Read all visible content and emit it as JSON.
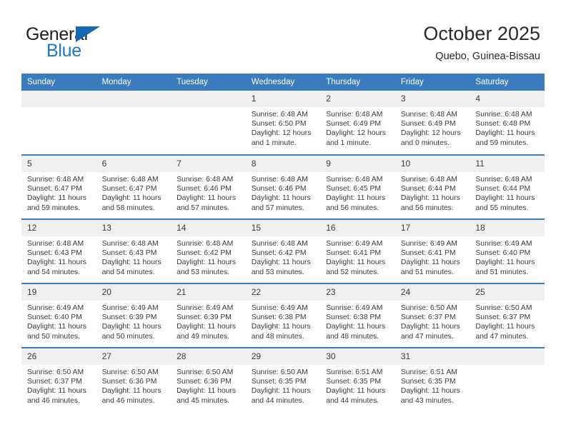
{
  "brand": {
    "name_top": "General",
    "name_bottom": "Blue",
    "accent_color": "#1a7ac4",
    "triangle_color": "#1668b3"
  },
  "header": {
    "title": "October 2025",
    "subtitle": "Quebo, Guinea-Bissau"
  },
  "calendar": {
    "header_bg": "#3a7cbe",
    "daynum_bg": "#efeff0",
    "weekdays": [
      "Sunday",
      "Monday",
      "Tuesday",
      "Wednesday",
      "Thursday",
      "Friday",
      "Saturday"
    ],
    "weeks": [
      [
        {
          "day": "",
          "sunrise": "",
          "sunset": "",
          "daylight_1": "",
          "daylight_2": ""
        },
        {
          "day": "",
          "sunrise": "",
          "sunset": "",
          "daylight_1": "",
          "daylight_2": ""
        },
        {
          "day": "",
          "sunrise": "",
          "sunset": "",
          "daylight_1": "",
          "daylight_2": ""
        },
        {
          "day": "1",
          "sunrise": "Sunrise: 6:48 AM",
          "sunset": "Sunset: 6:50 PM",
          "daylight_1": "Daylight: 12 hours",
          "daylight_2": "and 1 minute."
        },
        {
          "day": "2",
          "sunrise": "Sunrise: 6:48 AM",
          "sunset": "Sunset: 6:49 PM",
          "daylight_1": "Daylight: 12 hours",
          "daylight_2": "and 1 minute."
        },
        {
          "day": "3",
          "sunrise": "Sunrise: 6:48 AM",
          "sunset": "Sunset: 6:49 PM",
          "daylight_1": "Daylight: 12 hours",
          "daylight_2": "and 0 minutes."
        },
        {
          "day": "4",
          "sunrise": "Sunrise: 6:48 AM",
          "sunset": "Sunset: 6:48 PM",
          "daylight_1": "Daylight: 11 hours",
          "daylight_2": "and 59 minutes."
        }
      ],
      [
        {
          "day": "5",
          "sunrise": "Sunrise: 6:48 AM",
          "sunset": "Sunset: 6:47 PM",
          "daylight_1": "Daylight: 11 hours",
          "daylight_2": "and 59 minutes."
        },
        {
          "day": "6",
          "sunrise": "Sunrise: 6:48 AM",
          "sunset": "Sunset: 6:47 PM",
          "daylight_1": "Daylight: 11 hours",
          "daylight_2": "and 58 minutes."
        },
        {
          "day": "7",
          "sunrise": "Sunrise: 6:48 AM",
          "sunset": "Sunset: 6:46 PM",
          "daylight_1": "Daylight: 11 hours",
          "daylight_2": "and 57 minutes."
        },
        {
          "day": "8",
          "sunrise": "Sunrise: 6:48 AM",
          "sunset": "Sunset: 6:46 PM",
          "daylight_1": "Daylight: 11 hours",
          "daylight_2": "and 57 minutes."
        },
        {
          "day": "9",
          "sunrise": "Sunrise: 6:48 AM",
          "sunset": "Sunset: 6:45 PM",
          "daylight_1": "Daylight: 11 hours",
          "daylight_2": "and 56 minutes."
        },
        {
          "day": "10",
          "sunrise": "Sunrise: 6:48 AM",
          "sunset": "Sunset: 6:44 PM",
          "daylight_1": "Daylight: 11 hours",
          "daylight_2": "and 56 minutes."
        },
        {
          "day": "11",
          "sunrise": "Sunrise: 6:48 AM",
          "sunset": "Sunset: 6:44 PM",
          "daylight_1": "Daylight: 11 hours",
          "daylight_2": "and 55 minutes."
        }
      ],
      [
        {
          "day": "12",
          "sunrise": "Sunrise: 6:48 AM",
          "sunset": "Sunset: 6:43 PM",
          "daylight_1": "Daylight: 11 hours",
          "daylight_2": "and 54 minutes."
        },
        {
          "day": "13",
          "sunrise": "Sunrise: 6:48 AM",
          "sunset": "Sunset: 6:43 PM",
          "daylight_1": "Daylight: 11 hours",
          "daylight_2": "and 54 minutes."
        },
        {
          "day": "14",
          "sunrise": "Sunrise: 6:48 AM",
          "sunset": "Sunset: 6:42 PM",
          "daylight_1": "Daylight: 11 hours",
          "daylight_2": "and 53 minutes."
        },
        {
          "day": "15",
          "sunrise": "Sunrise: 6:48 AM",
          "sunset": "Sunset: 6:42 PM",
          "daylight_1": "Daylight: 11 hours",
          "daylight_2": "and 53 minutes."
        },
        {
          "day": "16",
          "sunrise": "Sunrise: 6:49 AM",
          "sunset": "Sunset: 6:41 PM",
          "daylight_1": "Daylight: 11 hours",
          "daylight_2": "and 52 minutes."
        },
        {
          "day": "17",
          "sunrise": "Sunrise: 6:49 AM",
          "sunset": "Sunset: 6:41 PM",
          "daylight_1": "Daylight: 11 hours",
          "daylight_2": "and 51 minutes."
        },
        {
          "day": "18",
          "sunrise": "Sunrise: 6:49 AM",
          "sunset": "Sunset: 6:40 PM",
          "daylight_1": "Daylight: 11 hours",
          "daylight_2": "and 51 minutes."
        }
      ],
      [
        {
          "day": "19",
          "sunrise": "Sunrise: 6:49 AM",
          "sunset": "Sunset: 6:40 PM",
          "daylight_1": "Daylight: 11 hours",
          "daylight_2": "and 50 minutes."
        },
        {
          "day": "20",
          "sunrise": "Sunrise: 6:49 AM",
          "sunset": "Sunset: 6:39 PM",
          "daylight_1": "Daylight: 11 hours",
          "daylight_2": "and 50 minutes."
        },
        {
          "day": "21",
          "sunrise": "Sunrise: 6:49 AM",
          "sunset": "Sunset: 6:39 PM",
          "daylight_1": "Daylight: 11 hours",
          "daylight_2": "and 49 minutes."
        },
        {
          "day": "22",
          "sunrise": "Sunrise: 6:49 AM",
          "sunset": "Sunset: 6:38 PM",
          "daylight_1": "Daylight: 11 hours",
          "daylight_2": "and 48 minutes."
        },
        {
          "day": "23",
          "sunrise": "Sunrise: 6:49 AM",
          "sunset": "Sunset: 6:38 PM",
          "daylight_1": "Daylight: 11 hours",
          "daylight_2": "and 48 minutes."
        },
        {
          "day": "24",
          "sunrise": "Sunrise: 6:50 AM",
          "sunset": "Sunset: 6:37 PM",
          "daylight_1": "Daylight: 11 hours",
          "daylight_2": "and 47 minutes."
        },
        {
          "day": "25",
          "sunrise": "Sunrise: 6:50 AM",
          "sunset": "Sunset: 6:37 PM",
          "daylight_1": "Daylight: 11 hours",
          "daylight_2": "and 47 minutes."
        }
      ],
      [
        {
          "day": "26",
          "sunrise": "Sunrise: 6:50 AM",
          "sunset": "Sunset: 6:37 PM",
          "daylight_1": "Daylight: 11 hours",
          "daylight_2": "and 46 minutes."
        },
        {
          "day": "27",
          "sunrise": "Sunrise: 6:50 AM",
          "sunset": "Sunset: 6:36 PM",
          "daylight_1": "Daylight: 11 hours",
          "daylight_2": "and 46 minutes."
        },
        {
          "day": "28",
          "sunrise": "Sunrise: 6:50 AM",
          "sunset": "Sunset: 6:36 PM",
          "daylight_1": "Daylight: 11 hours",
          "daylight_2": "and 45 minutes."
        },
        {
          "day": "29",
          "sunrise": "Sunrise: 6:50 AM",
          "sunset": "Sunset: 6:35 PM",
          "daylight_1": "Daylight: 11 hours",
          "daylight_2": "and 44 minutes."
        },
        {
          "day": "30",
          "sunrise": "Sunrise: 6:51 AM",
          "sunset": "Sunset: 6:35 PM",
          "daylight_1": "Daylight: 11 hours",
          "daylight_2": "and 44 minutes."
        },
        {
          "day": "31",
          "sunrise": "Sunrise: 6:51 AM",
          "sunset": "Sunset: 6:35 PM",
          "daylight_1": "Daylight: 11 hours",
          "daylight_2": "and 43 minutes."
        },
        {
          "day": "",
          "sunrise": "",
          "sunset": "",
          "daylight_1": "",
          "daylight_2": ""
        }
      ]
    ]
  }
}
